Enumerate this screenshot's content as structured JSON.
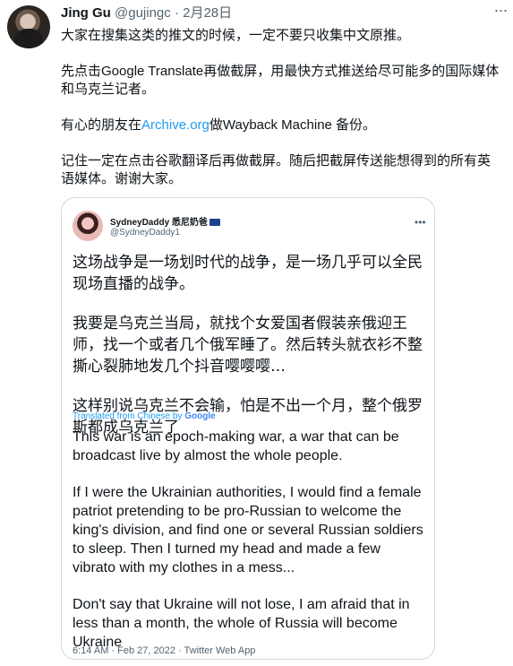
{
  "tweet": {
    "author_name": "Jing Gu",
    "author_handle": "@gujingc",
    "separator": "·",
    "date": "2月28日",
    "paragraphs": [
      "大家在搜集这类的推文的时候，一定不要只收集中文原推。",
      "先点击Google Translate再做截屏，用最快方式推送给尽可能多的国际媒体和乌克兰记者。",
      "记住一定在点击谷歌翻译后再做截屏。随后把截屏传送能想得到的所有英语媒体。谢谢大家。"
    ],
    "archive_pre": "有心的朋友在",
    "archive_link": "Archive.org",
    "archive_post": "做Wayback Machine 备份。"
  },
  "quoted": {
    "name": "SydneyDaddy 悉尼奶爸",
    "handle": "@SydneyDaddy1",
    "chinese_paragraphs": [
      "这场战争是一场划时代的战争，是一场几乎可以全民现场直播的战争。",
      "我要是乌克兰当局，就找个女爱国者假装亲俄迎王师，找一个或者几个俄军睡了。然后转头就衣衫不整撕心裂肺地发几个抖音嘤嘤嘤…",
      "这样别说乌克兰不会输，怕是不出一个月，整个俄罗斯都成乌克兰了"
    ],
    "translated_label": "Translated from Chinese by",
    "google": "Google",
    "english_paragraphs": [
      "This war is an epoch-making war, a war that can be broadcast live by almost the whole people.",
      "If I were the Ukrainian authorities, I would find a female patriot pretending to be pro-Russian to welcome the king's division, and find one or several Russian soldiers to sleep. Then I turned my head and made a few vibrato with my clothes in a mess...",
      "Don't say that Ukraine will not lose, I am afraid that in less than a month, the whole of Russia will become Ukraine"
    ],
    "timestamp": "6:14 AM · Feb 27, 2022 · Twitter Web App"
  },
  "icons": {
    "more": "more-icon",
    "flag": "australia-flag-icon"
  }
}
